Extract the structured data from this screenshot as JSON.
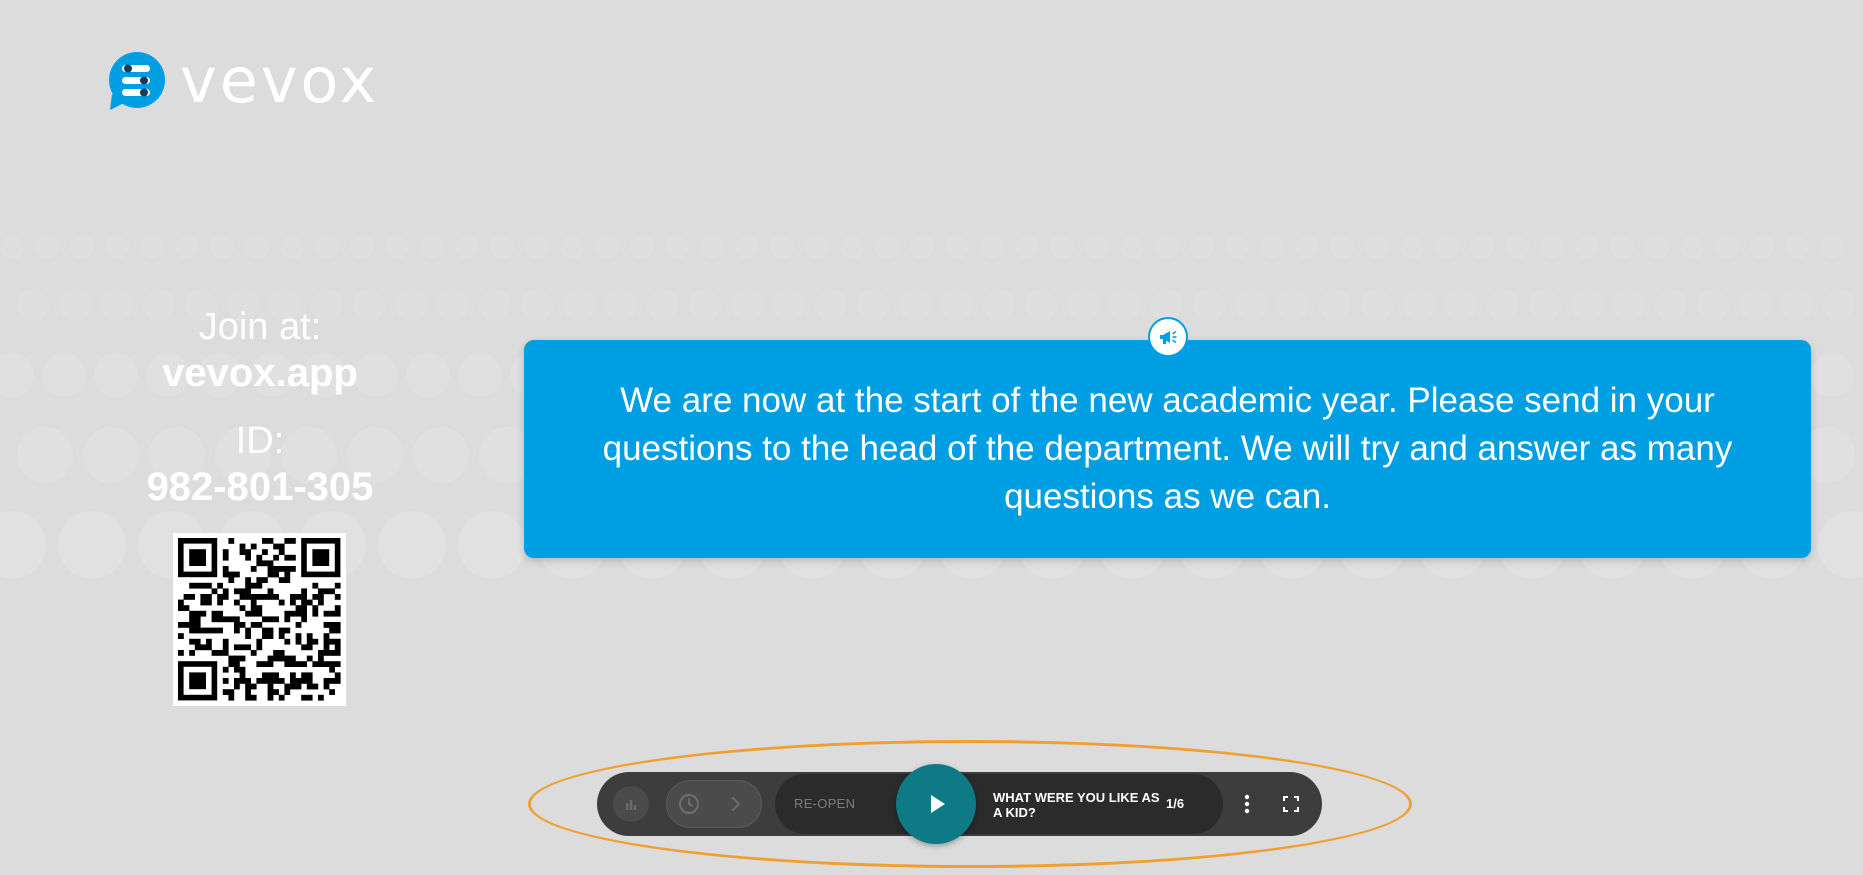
{
  "brand": {
    "name": "vevox",
    "logo_icon": "vevox-speech-bubble-icon",
    "accent_color": "#009fe3"
  },
  "join": {
    "label": "Join at:",
    "url": "vevox.app",
    "id_label": "ID:",
    "id_value": "982-801-305",
    "qr_icon": "qr-code"
  },
  "announcement": {
    "badge_icon": "megaphone-icon",
    "text": "We are now at the start of the new academic year. Please send in your questions to the head of the department. We will try and answer as many questions as we can."
  },
  "controls": {
    "chart_icon": "bar-chart-icon",
    "timer_icon": "clock-icon",
    "next_icon": "chevron-right-icon",
    "reopen_label": "RE-OPEN",
    "play_icon": "play-icon",
    "play_color": "#0d7a86",
    "question_title": "WHAT WERE YOU LIKE AS A KID?",
    "question_count": "1/6",
    "more_icon": "vertical-dots-icon",
    "fullscreen_icon": "fullscreen-icon"
  }
}
